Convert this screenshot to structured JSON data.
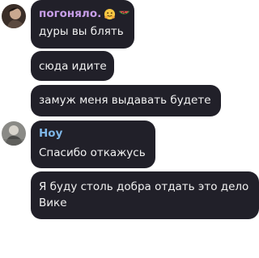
{
  "messages": [
    {
      "sender": "погоняло.",
      "sender_color": "#c79ee8",
      "sender_emojis": [
        "hugging-face-emoji",
        "watermelon-emoji"
      ],
      "text": "дуры вы блять"
    },
    {
      "text": "сюда идите"
    },
    {
      "text": "замуж меня выдавать будете"
    },
    {
      "sender": "Ноу",
      "sender_color": "#7fb7e8",
      "text": "Спасибо откажусь"
    },
    {
      "text": "Я буду столь добра отдать это дело Вике"
    }
  ],
  "colors": {
    "bubble": "#212029",
    "message_text": "#f2f2f2",
    "background": "#ffffff"
  }
}
